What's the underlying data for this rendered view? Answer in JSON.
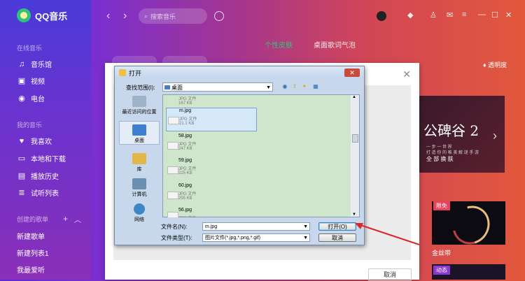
{
  "app": {
    "title": "QQ音乐"
  },
  "sidebar": {
    "sections": [
      {
        "label": "在线音乐",
        "items": [
          "音乐馆",
          "视频",
          "电台"
        ]
      },
      {
        "label": "我的音乐",
        "items": [
          "我喜欢",
          "本地和下载",
          "播放历史",
          "试听列表"
        ]
      }
    ],
    "created_label": "创建的歌单",
    "playlists": [
      "新建歌单",
      "新建列表1",
      "我最爱听"
    ],
    "icons": [
      "music-note-icon",
      "video-icon",
      "radio-icon",
      "heart-icon",
      "monitor-icon",
      "history-icon",
      "list-icon"
    ]
  },
  "topbar": {
    "search_placeholder": "搜索音乐"
  },
  "skin_tabs": [
    "个性皮肤",
    "桌面歌词气泡"
  ],
  "transparency_label": "透明度",
  "banner": {
    "title": "公碑谷 2",
    "subtitle": "一 步 一 世 界",
    "tagline": "打 造 你 的 唯 美 解 谜 手 游",
    "cta": "全 部 换 肤"
  },
  "cards": [
    {
      "tag": "限免",
      "title": "金丝带"
    },
    {
      "tag": "动态"
    }
  ],
  "skin_panel": {
    "cancel_label": "取消"
  },
  "dialog": {
    "title": "打开",
    "look_in_label": "查找范围(I):",
    "look_in_value": "桌面",
    "places": [
      "最近访问的位置",
      "桌面",
      "库",
      "计算机",
      "网络"
    ],
    "files": [
      {
        "name": "",
        "type": "JPG 文件",
        "size": "167 KB"
      },
      {
        "name": "m.jpg",
        "type": "JPG 文件",
        "size": "21.1 KB"
      },
      {
        "name": "58.jpg",
        "type": "JPG 文件",
        "size": "247 KB"
      },
      {
        "name": "59.jpg",
        "type": "JPG 文件",
        "size": "225 KB"
      },
      {
        "name": "60.jpg",
        "type": "JPG 文件",
        "size": "255 KB"
      },
      {
        "name": "56.jpg",
        "type": "JPG 文件",
        "size": ""
      }
    ],
    "filename_label": "文件名(N):",
    "filename_value": "m.jpg",
    "filetype_label": "文件类型(T):",
    "filetype_value": "图片文件(*.jpg,*.png,*.gif)",
    "open_label": "打开(O)",
    "cancel_label": "取消"
  },
  "colors": {
    "accent_green": "#31c27c",
    "arrow_red": "#e0262b"
  }
}
